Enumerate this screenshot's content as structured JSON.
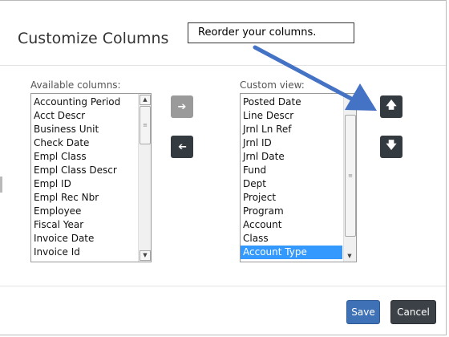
{
  "dialog": {
    "title": "Customize Columns",
    "callout": "Reorder your columns."
  },
  "available": {
    "label": "Available columns:",
    "items": [
      "Accounting Period",
      "Acct Descr",
      "Business Unit",
      "Check Date",
      "Empl Class",
      "Empl Class Descr",
      "Empl ID",
      "Empl Rec Nbr",
      "Employee",
      "Fiscal Year",
      "Invoice Date",
      "Invoice Id"
    ]
  },
  "custom": {
    "label": "Custom view:",
    "items": [
      "Posted Date",
      "Line Descr",
      "Jrnl Ln Ref",
      "Jrnl ID",
      "Jrnl Date",
      "Fund",
      "Dept",
      "Project",
      "Program",
      "Account",
      "Class",
      "Account Type"
    ],
    "selected": "Account Type"
  },
  "icons": {
    "add": "arrow-right-icon",
    "remove": "arrow-left-icon",
    "up": "arrow-up-icon",
    "down": "arrow-down-icon"
  },
  "colors": {
    "selection": "#3399ff",
    "save": "#3f71b7",
    "dark_button": "#333a40",
    "callout_arrow": "#4472c4"
  },
  "footer": {
    "save_label": "Save",
    "cancel_label": "Cancel"
  }
}
